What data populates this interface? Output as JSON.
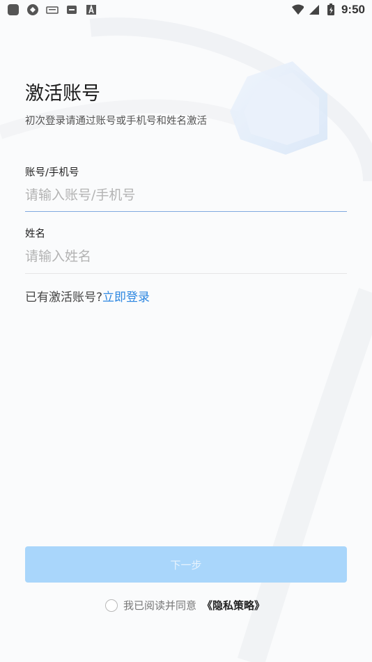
{
  "status_bar": {
    "time": "9:50",
    "left_icons": [
      "app-icon",
      "sync-icon",
      "keyboard-icon",
      "notification-icon",
      "text-a-icon"
    ],
    "right_icons": [
      "wifi-icon",
      "signal-icon",
      "battery-icon"
    ]
  },
  "header": {
    "title": "激活账号",
    "subtitle": "初次登录请通过账号或手机号和姓名激活"
  },
  "form": {
    "account": {
      "label": "账号/手机号",
      "placeholder": "请输入账号/手机号",
      "value": ""
    },
    "name": {
      "label": "姓名",
      "placeholder": "请输入姓名",
      "value": ""
    }
  },
  "login_prompt": {
    "text": "已有激活账号?",
    "link": "立即登录"
  },
  "next_button": {
    "label": "下一步"
  },
  "agreement": {
    "text": "我已阅读并同意",
    "link": "《隐私策略》",
    "checked": false
  },
  "colors": {
    "accent": "#2d87e1",
    "button_disabled": "#a9d6fb",
    "focus_underline": "#7fa9df"
  }
}
